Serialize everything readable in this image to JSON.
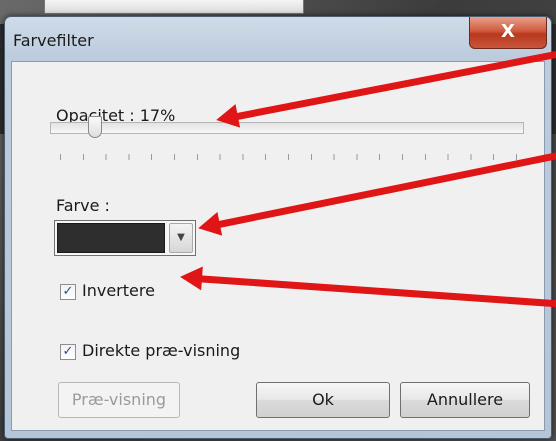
{
  "dialog": {
    "title": "Farvefilter",
    "close_label": "X"
  },
  "opacity": {
    "label": "Opacitet : 17%",
    "value_percent": 17
  },
  "color": {
    "label": "Farve :",
    "selected_color": "#2e2e2e"
  },
  "options": {
    "invert_label": "Invertere",
    "invert_checked": true,
    "preview_live_label": "Direkte præ-visning",
    "preview_live_checked": true
  },
  "buttons": {
    "preview_label": "Præ-visning",
    "ok_label": "Ok",
    "cancel_label": "Annullere"
  },
  "annotations": {
    "arrow_color": "#e01515"
  }
}
